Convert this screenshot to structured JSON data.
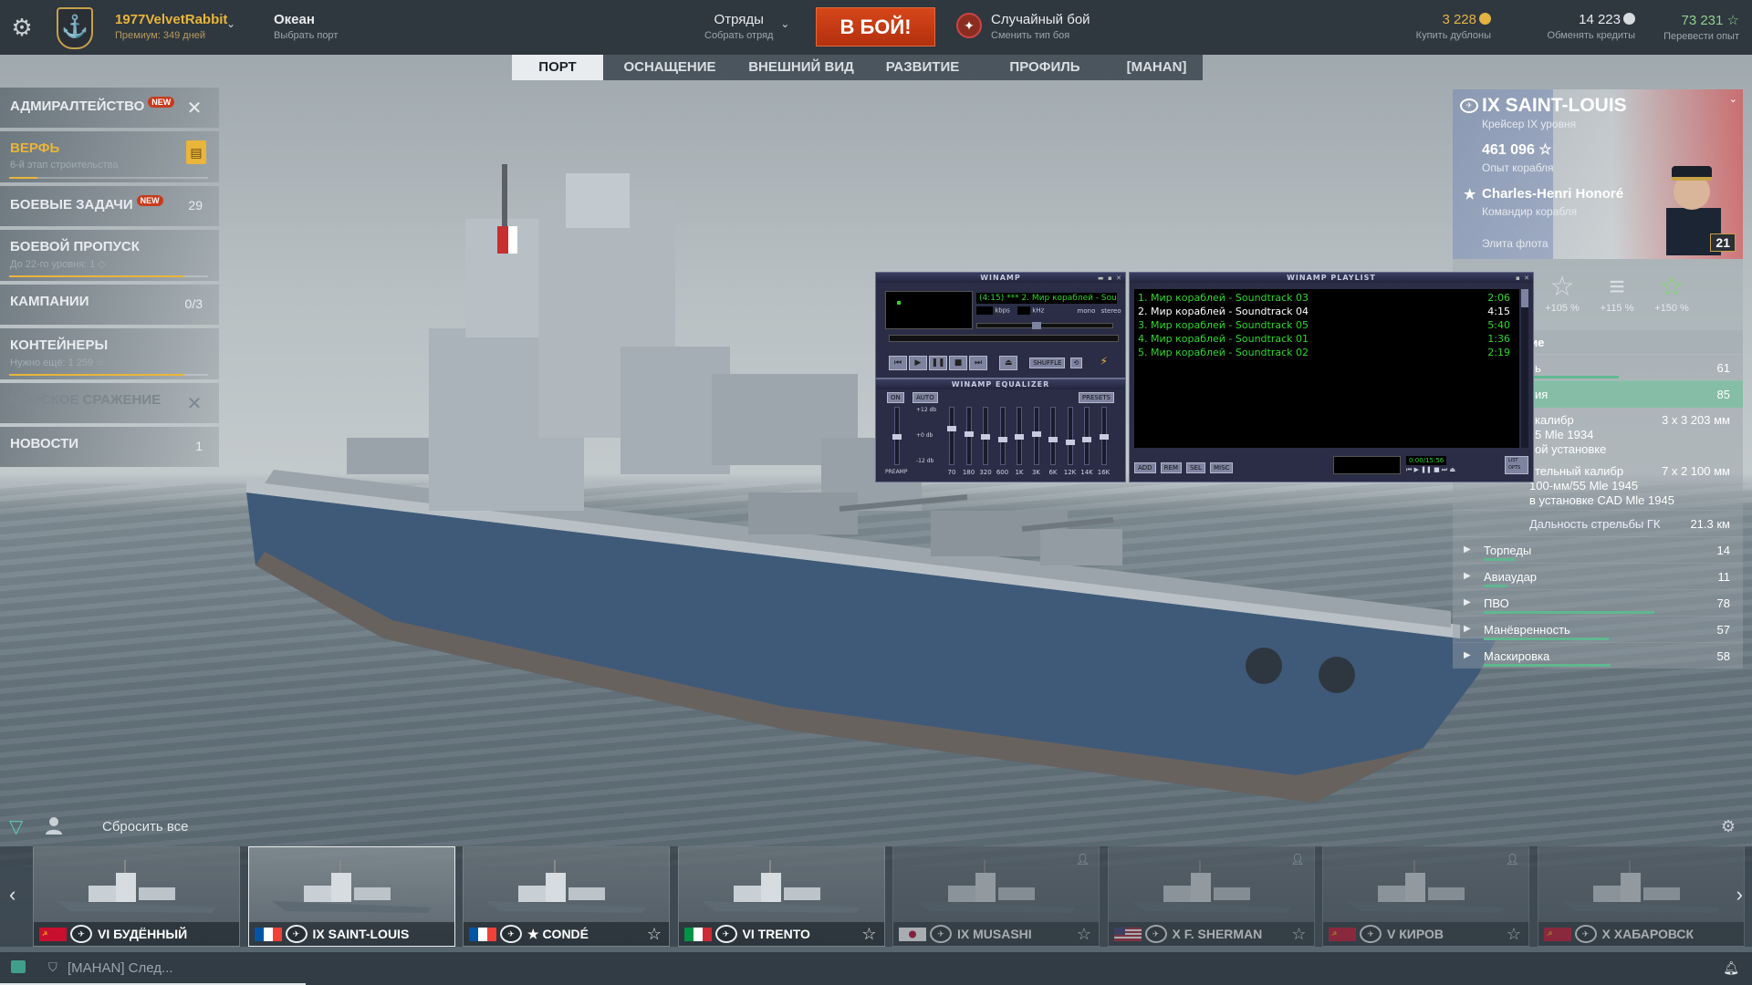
{
  "topbar": {
    "username": "1977VelvetRabbit",
    "premium": "Премиум: 349 дней",
    "server": {
      "title": "Океан",
      "subtitle": "Выбрать порт"
    },
    "squad": {
      "title": "Отряды",
      "subtitle": "Собрать отряд"
    },
    "battle_button": "В БОЙ!",
    "battle_type": {
      "title": "Случайный бой",
      "subtitle": "Сменить тип боя"
    },
    "doubloons": {
      "value": "3 228",
      "subtitle": "Купить дублоны"
    },
    "credits": {
      "value": "14 223",
      "subtitle": "Обменять кредиты"
    },
    "free_xp": {
      "value": "73 231",
      "subtitle": "Перевести опыт"
    }
  },
  "tabs": [
    "ПОРТ",
    "ОСНАЩЕНИЕ",
    "ВНЕШНИЙ ВИД",
    "РАЗВИТИЕ",
    "ПРОФИЛЬ",
    "[MAHAN]"
  ],
  "leftmenu": {
    "admiralty": {
      "label": "АДМИРАЛТЕЙСТВО",
      "badge": "NEW"
    },
    "shipyard": {
      "label": "ВЕРФЬ",
      "sub": "6-й этап строительства",
      "progress": 0.14
    },
    "missions": {
      "label": "БОЕВЫЕ ЗАДАЧИ",
      "badge": "NEW",
      "count": "29"
    },
    "pass": {
      "label": "БОЕВОЙ ПРОПУСК",
      "sub": "До 22-го уровня:",
      "sub_value": "1",
      "progress": 0.88
    },
    "campaigns": {
      "label": "КАМПАНИИ",
      "count": "0/3"
    },
    "containers": {
      "label": "КОНТЕЙНЕРЫ",
      "sub": "Нужно ещё: 1 259",
      "progress": 0.88
    },
    "naval": {
      "label": "МОРСКОЕ СРАЖЕНИЕ"
    },
    "news": {
      "label": "НОВОСТИ",
      "count": "1"
    }
  },
  "ship": {
    "name": "IX SAINT-LOUIS",
    "tier": "Крейсер IX уровня",
    "xp": "461 096",
    "xp_label": "Опыт корабля",
    "commander": "Charles-Henri Honoré",
    "commander_label": "Командир корабля",
    "elite": "Элита флота",
    "commander_level": "21"
  },
  "upgrades": [
    "+105 %",
    "+115 %",
    "+150 %"
  ],
  "stats": {
    "header": "ание",
    "rows": [
      {
        "name": "ь",
        "value": "61",
        "pct": 0.61
      },
      {
        "name": "ия",
        "value": "85",
        "pct": 0.85
      }
    ],
    "main_battery": {
      "l1": "калибр",
      "l2": "5 Mle 1934",
      "l3": "ой установке",
      "value": "3 x 3  203  мм"
    },
    "secondary": {
      "l1": "тельный калибр",
      "l2": "100-мм/55 Mle 1945",
      "l3": "в установке CAD Mle 1945",
      "value": "7 x 2  100  мм"
    },
    "range": {
      "name": "Дальность стрельбы ГК",
      "value": "21.3 км"
    },
    "extra": [
      {
        "name": "Торпеды",
        "value": "14",
        "pct": 0.14
      },
      {
        "name": "Авиаудар",
        "value": "11",
        "pct": 0.11
      },
      {
        "name": "ПВО",
        "value": "78",
        "pct": 0.78
      },
      {
        "name": "Манёвренность",
        "value": "57",
        "pct": 0.57
      },
      {
        "name": "Маскировка",
        "value": "58",
        "pct": 0.58
      }
    ]
  },
  "winamp": {
    "title": "WINAMP",
    "ticker": "(4:15) *** 2. Мир кораблей - Soundtrack 04",
    "kbps": "kbps",
    "khz": "kHz",
    "mono": "mono",
    "stereo": "stereo",
    "shuffle": "SHUFFLE",
    "eq_title": "WINAMP EQUALIZER",
    "eq_on": "ON",
    "eq_auto": "AUTO",
    "presets": "PRESETS",
    "eq_db_top": "+12 db",
    "eq_db_mid": "+0 db",
    "eq_db_bot": "-12 db",
    "preamp": "PREAMP",
    "eq_bands": [
      "70",
      "180",
      "320",
      "600",
      "1K",
      "3K",
      "6K",
      "12K",
      "14K",
      "16K"
    ],
    "eq_levels": [
      0.35,
      0.45,
      0.5,
      0.55,
      0.5,
      0.45,
      0.55,
      0.6,
      0.55,
      0.5
    ],
    "pl_title": "WINAMP PLAYLIST",
    "playlist": [
      {
        "title": "1. Мир кораблей - Soundtrack 03",
        "dur": "2:06"
      },
      {
        "title": "2. Мир кораблей - Soundtrack 04",
        "dur": "4:15"
      },
      {
        "title": "3. Мир кораблей - Soundtrack 05",
        "dur": "5:40"
      },
      {
        "title": "4. Мир кораблей - Soundtrack 01",
        "dur": "1:36"
      },
      {
        "title": "5. Мир кораблей - Soundtrack 02",
        "dur": "2:19"
      }
    ],
    "pl_buttons": [
      "ADD",
      "REM",
      "SEL",
      "MISC"
    ],
    "pl_time": "0:00/15:56",
    "list_opts": "LIST OPTS"
  },
  "carousel": {
    "reset": "Сбросить все",
    "cards": [
      {
        "name": "VI БУДЁННЫЙ",
        "flag": "ussr",
        "fav": false,
        "dim": false,
        "sel": false,
        "lock": false
      },
      {
        "name": "IX SAINT-LOUIS",
        "flag": "france",
        "fav": false,
        "dim": false,
        "sel": true,
        "lock": false
      },
      {
        "name": "★ CONDÉ",
        "flag": "france",
        "fav": true,
        "dim": false,
        "sel": false,
        "lock": false
      },
      {
        "name": "VI TRENTO",
        "flag": "italy",
        "fav": true,
        "dim": false,
        "sel": false,
        "lock": false
      },
      {
        "name": "IX MUSASHI",
        "flag": "japan",
        "fav": true,
        "dim": true,
        "sel": false,
        "lock": true
      },
      {
        "name": "X F. SHERMAN",
        "flag": "usa",
        "fav": true,
        "dim": true,
        "sel": false,
        "lock": true
      },
      {
        "name": "V КИРОВ",
        "flag": "ussr",
        "fav": true,
        "dim": true,
        "sel": false,
        "lock": true
      },
      {
        "name": "X ХАБАРОВСК",
        "flag": "ussr",
        "fav": false,
        "dim": true,
        "sel": false,
        "lock": false
      }
    ]
  },
  "chat": {
    "text": "[MAHAN] След..."
  },
  "colors": {
    "accent": "#e9b53a",
    "battle": "#c9391a",
    "stat_bar": "#5fb88f",
    "winamp_text": "#2fd62f"
  }
}
